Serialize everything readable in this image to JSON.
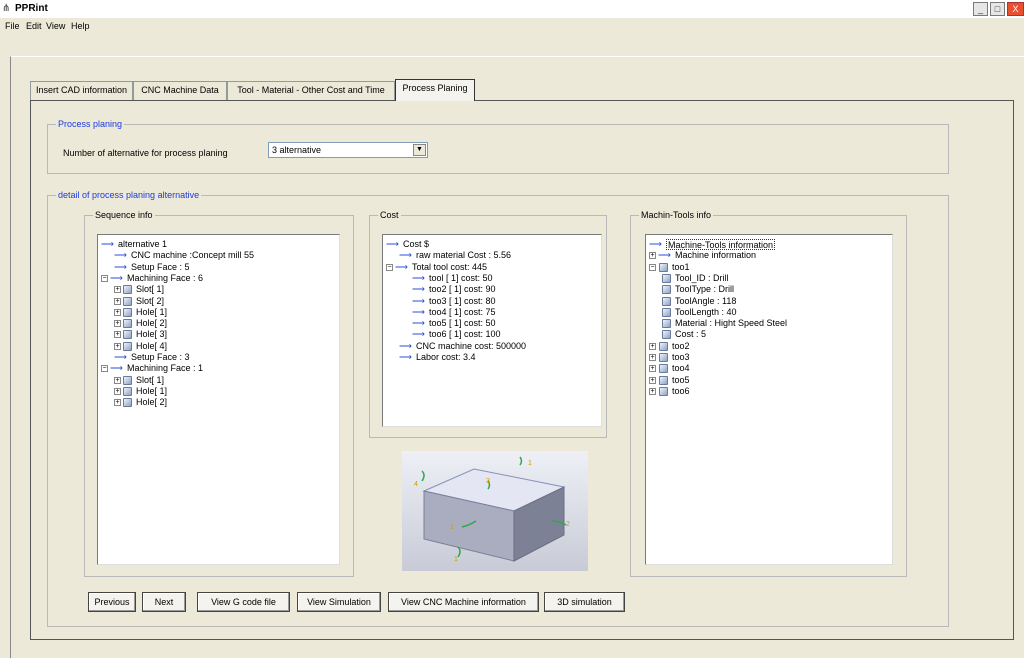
{
  "app": {
    "title": "PPRint",
    "window_buttons": {
      "minimize": "_",
      "maximize": "□",
      "close": "X"
    }
  },
  "menu": [
    "File",
    "Edit",
    "View",
    "Help"
  ],
  "tabs": [
    "Insert CAD information",
    "CNC Machine Data",
    "Tool - Material - Other Cost and Time",
    "Process Planing"
  ],
  "process_planing": {
    "legend": "Process planing",
    "alt_label": "Number of alternative for process planing",
    "alt_value": "3 alternative"
  },
  "detail": {
    "legend": "detail of process planing alternative"
  },
  "sequence": {
    "legend": "Sequence info",
    "nodes": [
      {
        "text": "alternative 1",
        "level": 0,
        "type": "arrow"
      },
      {
        "text": "CNC machine :Concept mill 55",
        "level": 1,
        "type": "arrow"
      },
      {
        "text": "Setup Face : 5",
        "level": 1,
        "type": "arrow"
      },
      {
        "text": "Machining Face : 6",
        "level": 0,
        "type": "expand"
      },
      {
        "text": "Slot[ 1]",
        "level": 1,
        "type": "icon"
      },
      {
        "text": "Slot[ 2]",
        "level": 1,
        "type": "icon"
      },
      {
        "text": "Hole[ 1]",
        "level": 1,
        "type": "icon"
      },
      {
        "text": "Hole[ 2]",
        "level": 1,
        "type": "icon"
      },
      {
        "text": "Hole[ 3]",
        "level": 1,
        "type": "icon"
      },
      {
        "text": "Hole[ 4]",
        "level": 1,
        "type": "icon"
      },
      {
        "text": "Setup Face : 3",
        "level": 1,
        "type": "arrow"
      },
      {
        "text": "Machining Face : 1",
        "level": 0,
        "type": "expand"
      },
      {
        "text": "Slot[ 1]",
        "level": 1,
        "type": "icon"
      },
      {
        "text": "Hole[ 1]",
        "level": 1,
        "type": "icon"
      },
      {
        "text": "Hole[ 2]",
        "level": 1,
        "type": "icon"
      }
    ]
  },
  "cost": {
    "legend": "Cost",
    "nodes": [
      {
        "text": "Cost $",
        "level": 0,
        "type": "arrow"
      },
      {
        "text": "raw material Cost : 5.56",
        "level": 1,
        "type": "arrow"
      },
      {
        "text": "Total tool cost:  445",
        "level": 0,
        "type": "expand"
      },
      {
        "text": "tool [ 1] cost:  50",
        "level": 2,
        "type": "arrow"
      },
      {
        "text": "too2 [ 1] cost:  90",
        "level": 2,
        "type": "arrow"
      },
      {
        "text": "too3 [ 1] cost:  80",
        "level": 2,
        "type": "arrow"
      },
      {
        "text": "too4 [ 1] cost:  75",
        "level": 2,
        "type": "arrow"
      },
      {
        "text": "too5 [ 1] cost:  50",
        "level": 2,
        "type": "arrow"
      },
      {
        "text": "too6 [ 1] cost:  100",
        "level": 2,
        "type": "arrow"
      },
      {
        "text": "CNC machine cost:  500000",
        "level": 1,
        "type": "arrow"
      },
      {
        "text": "Labor cost:  3.4",
        "level": 1,
        "type": "arrow"
      }
    ]
  },
  "machine": {
    "legend": "Machin-Tools info",
    "nodes": [
      {
        "text": "Machine-Tools information",
        "level": 0,
        "type": "arrow"
      },
      {
        "text": "Machine information",
        "level": 0,
        "type": "plusarrow"
      },
      {
        "text": "too1",
        "level": 0,
        "type": "minusicon"
      },
      {
        "text": "Tool_ID : Drill",
        "level": 1,
        "type": "icon"
      },
      {
        "text": "ToolType : Drill",
        "level": 1,
        "type": "icon"
      },
      {
        "text": "ToolAngle :  118",
        "level": 1,
        "type": "icon"
      },
      {
        "text": "ToolLength :  40",
        "level": 1,
        "type": "icon"
      },
      {
        "text": "Material : Hight Speed Steel",
        "level": 1,
        "type": "icon"
      },
      {
        "text": "Cost :  5",
        "level": 1,
        "type": "icon"
      },
      {
        "text": "too2",
        "level": 0,
        "type": "plusicon"
      },
      {
        "text": "too3",
        "level": 0,
        "type": "plusicon"
      },
      {
        "text": "too4",
        "level": 0,
        "type": "plusicon"
      },
      {
        "text": "too5",
        "level": 0,
        "type": "plusicon"
      },
      {
        "text": "too6",
        "level": 0,
        "type": "plusicon"
      }
    ]
  },
  "cad_labels": [
    "3",
    "1",
    "2",
    "1",
    "4"
  ],
  "buttons": [
    "Previous",
    "Next",
    "View G code file",
    "View Simulation",
    "View CNC Machine information",
    "3D simulation"
  ],
  "colors": {
    "accent": "#1a3ae0",
    "arrow": "#2a4fd8",
    "background": "#ece9d8"
  }
}
